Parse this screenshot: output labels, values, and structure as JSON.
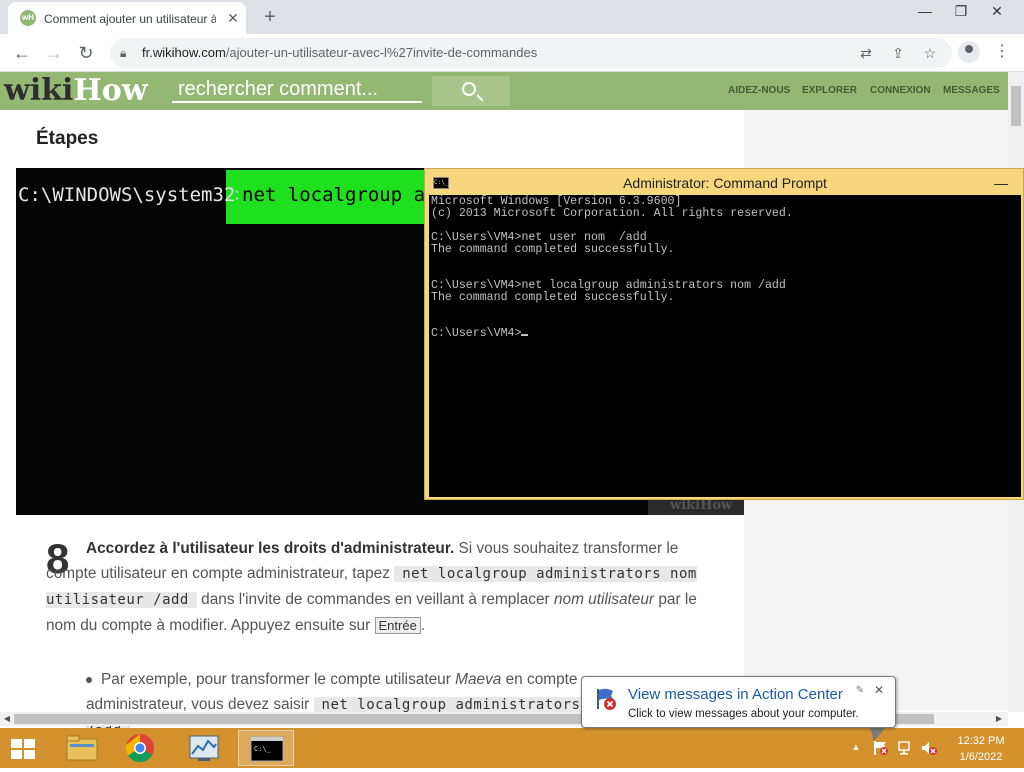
{
  "browser": {
    "tab_title": "Comment ajouter un utilisateur à",
    "tab_favicon": "wH",
    "tab_close": "✕",
    "new_tab": "+",
    "url_domain": "fr.wikihow.com",
    "url_path": "/ajouter-un-utilisateur-avec-l%27invite-de-commandes",
    "window_controls": {
      "minimize": "—",
      "restore": "❐",
      "close": "✕"
    }
  },
  "wikihow": {
    "logo_wiki": "wiki",
    "logo_how": "How",
    "search_placeholder": "rechercher comment...",
    "nav": [
      "AIDEZ-NOUS",
      "EXPLORER",
      "CONNEXION",
      "MESSAGES"
    ]
  },
  "article": {
    "section_title": "Étapes",
    "image_prompt": "C:\\WINDOWS\\system32>",
    "image_cmd": "net localgroup administrators",
    "image_watermark": "wikiHow",
    "step_number": "8",
    "step_bold": "Accordez à l'utilisateur les droits d'administrateur.",
    "step_t1": " Si vous souhaitez transformer le compte utilisateur en compte administrateur, tapez ",
    "step_code": "net localgroup administrators nom utilisateur /add",
    "step_t2": " dans l'invite de commandes en veillant à remplacer ",
    "step_em": "nom utilisateur",
    "step_t3": " par le nom du compte à modifier. Appuyez ensuite sur ",
    "step_key": "Entrée",
    "step_t4": ".",
    "bullet_t1": "Par exemple, pour transformer le compte utilisateur ",
    "bullet_em": "Maeva",
    "bullet_t2": " en compte administrateur, vous devez saisir ",
    "bullet_code": "net localgroup administrators Maeva /add"
  },
  "cmd": {
    "title": "Administrator: Command Prompt",
    "minimize": "—",
    "icon_text": "C:\\_",
    "output": "Microsoft Windows [Version 6.3.9600]\n(c) 2013 Microsoft Corporation. All rights reserved.\n\nC:\\Users\\VM4>net user nom  /add\nThe command completed successfully.\n\n\nC:\\Users\\VM4>net localgroup administrators nom /add\nThe command completed successfully.\n\n\nC:\\Users\\VM4>"
  },
  "notification": {
    "title": "View messages in Action Center",
    "subtitle": "Click to view messages about your computer.",
    "close": "✕",
    "pin": "✎"
  },
  "taskbar": {
    "time": "12:32 PM",
    "date": "1/6/2022",
    "tray_arrow": "▲"
  },
  "colors": {
    "wikihow_green": "#93b874",
    "taskbar": "#d4922f",
    "cmd_frame": "#f6d77d",
    "highlight_green": "#1fe01f"
  }
}
